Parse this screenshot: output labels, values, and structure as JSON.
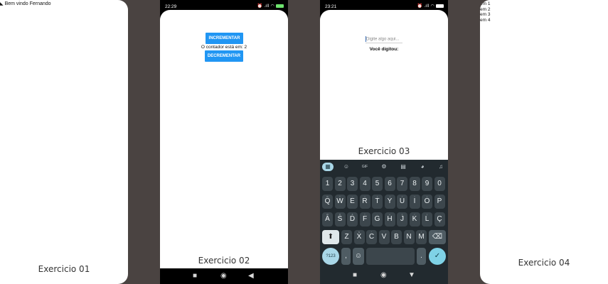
{
  "panel1": {
    "greeting": "Bem vindo Fernando",
    "caption": "Exercicio 01"
  },
  "panel2": {
    "status": {
      "time": "22:29",
      "icons": "⏰ .ıll ◠",
      "battery_color": "#6ee36e"
    },
    "increment_label": "INCREMENTAR",
    "counter_text": "O contador está em: 2",
    "counter_value": 2,
    "decrement_label": "DECREMENTAR",
    "caption": "Exercicio 02",
    "button_color": "#2196f3"
  },
  "panel3": {
    "status": {
      "time": "23:21",
      "icons": "⏰ .ıll ◠"
    },
    "input_placeholder": "Digite algo aqui...",
    "typed_label": "Você digitou:",
    "caption": "Exercicio 03",
    "keyboard": {
      "toolbar": [
        "apps-icon",
        "sticker-icon",
        "GIF",
        "gear-icon",
        "translate-icon",
        "palette-icon",
        "mic-icon"
      ],
      "gif_label": "GIF",
      "row_numbers": [
        "1",
        "2",
        "3",
        "4",
        "5",
        "6",
        "7",
        "8",
        "9",
        "0"
      ],
      "row_top": [
        "Q",
        "W",
        "E",
        "R",
        "T",
        "Y",
        "U",
        "I",
        "O",
        "P"
      ],
      "row_top_hints": [
        "%",
        "^",
        "~",
        "|",
        "[",
        "]",
        "<",
        ">",
        "{",
        "}"
      ],
      "row_mid": [
        "A",
        "S",
        "D",
        "F",
        "G",
        "H",
        "J",
        "K",
        "L",
        "Ç"
      ],
      "row_mid_hints": [
        "@",
        "#",
        "&",
        "*",
        "-",
        "+",
        "=",
        "(",
        ")",
        ""
      ],
      "row_bottom": [
        "Z",
        "X",
        "C",
        "V",
        "B",
        "N",
        "M"
      ],
      "row_bottom_hints": [
        "_",
        "$",
        "\"",
        "'",
        ":",
        ";",
        "/"
      ],
      "sym_label": "?123",
      "comma": ",",
      "period": ".",
      "accent_color": "#7fd2e6"
    }
  },
  "panel4": {
    "items": [
      "em 1",
      "em 2",
      "em 3",
      "em 4"
    ],
    "caption": "Exercicio 04"
  }
}
